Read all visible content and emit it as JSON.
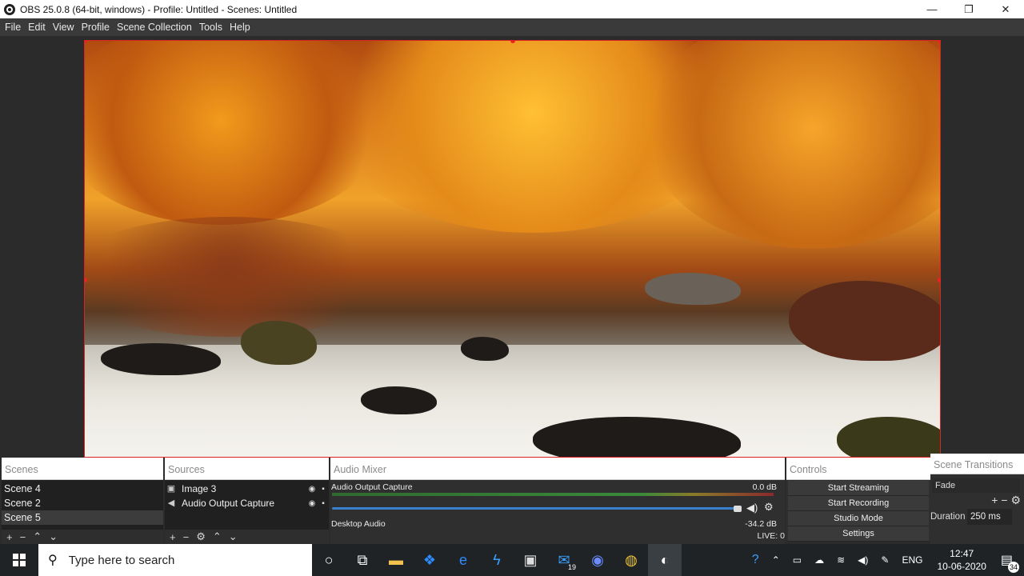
{
  "window": {
    "title": "OBS 25.0.8 (64-bit, windows) - Profile: Untitled - Scenes: Untitled",
    "controls": [
      "—",
      "❐",
      "✕"
    ]
  },
  "menu": [
    "File",
    "Edit",
    "View",
    "Profile",
    "Scene Collection",
    "Tools",
    "Help"
  ],
  "scenes": {
    "title": "Scenes",
    "items": [
      "Scene 4",
      "Scene 2",
      "Scene 5"
    ],
    "selected_index": 2
  },
  "sources": {
    "title": "Sources",
    "items": [
      {
        "name": "Image 3",
        "icon": "image-icon"
      },
      {
        "name": "Audio Output Capture",
        "icon": "speaker-icon"
      }
    ]
  },
  "mixer": {
    "title": "Audio Mixer",
    "channels": [
      {
        "name": "Audio Output Capture",
        "db": "0.0 dB"
      },
      {
        "name": "Desktop Audio",
        "db": "-34.2 dB"
      }
    ],
    "status": "LIVE: 0"
  },
  "controls": {
    "title": "Controls",
    "buttons": [
      "Start Streaming",
      "Start Recording",
      "Studio Mode",
      "Settings"
    ]
  },
  "transitions": {
    "title": "Scene Transitions",
    "selected": "Fade",
    "duration_label": "Duration",
    "duration_value": "250 ms"
  },
  "taskbar": {
    "search_placeholder": "Type here to search",
    "mail_badge": "19",
    "language": "ENG",
    "time": "12:47",
    "date": "10-06-2020",
    "notifications": "34"
  },
  "colors": {
    "selection_border": "#dd2222",
    "slider": "#3a7fd0"
  }
}
